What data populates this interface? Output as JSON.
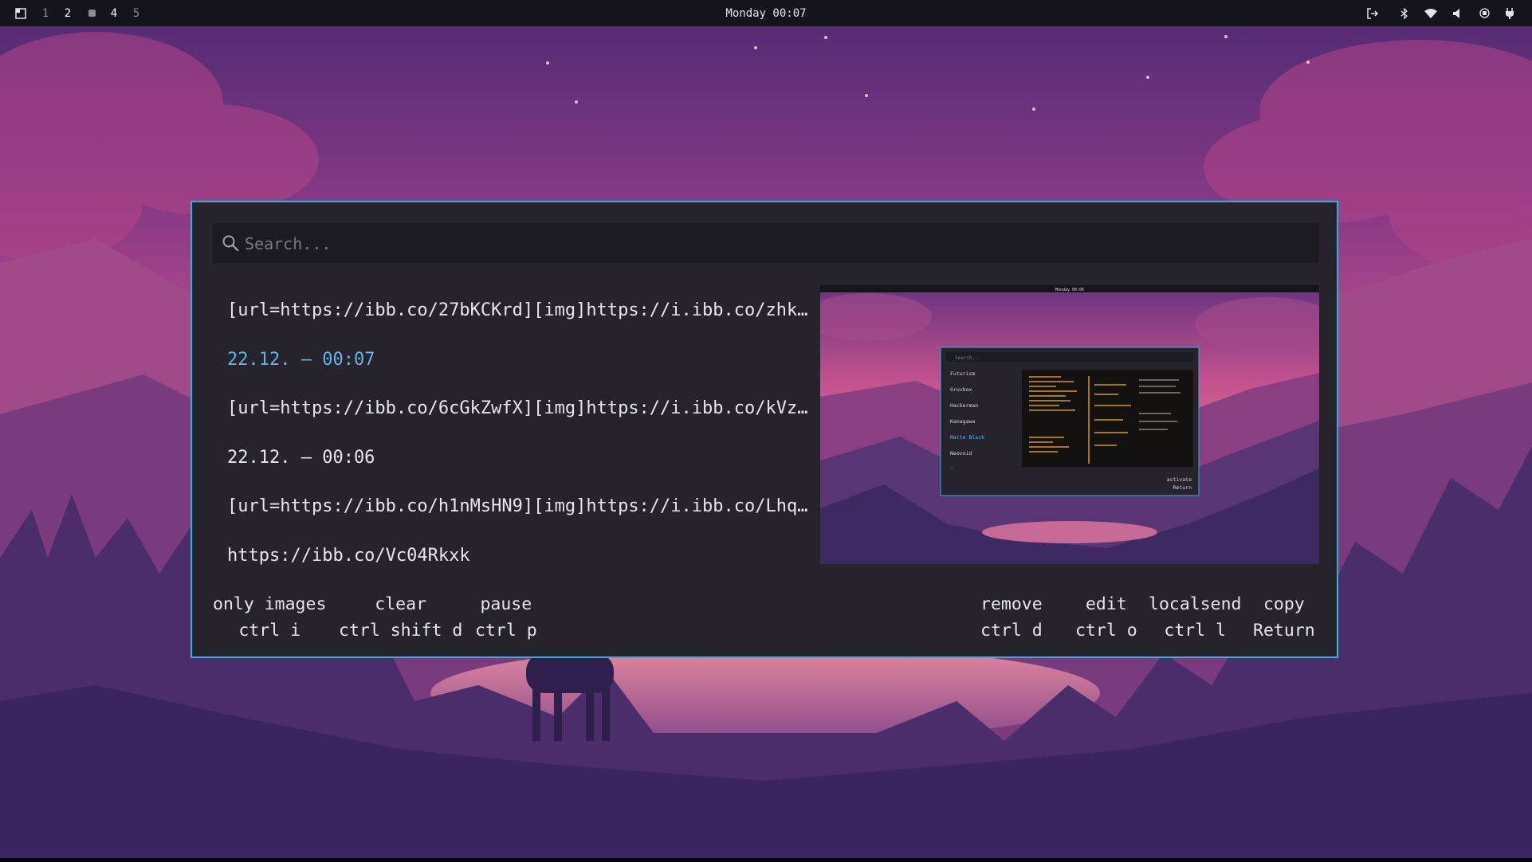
{
  "topbar": {
    "workspaces": [
      "1",
      "2",
      "",
      "4",
      "5"
    ],
    "active_workspace": "2",
    "clock": "Monday 00:07",
    "tray_icons": [
      "logout-icon",
      "bluetooth-icon",
      "wifi-icon",
      "volume-icon",
      "cpu-icon",
      "battery-icon"
    ]
  },
  "dialog": {
    "accent": "#2fb1de",
    "search": {
      "placeholder": "Search..."
    },
    "items": [
      "[url=https://ibb.co/27bKCKrd][img]https://i.ibb.co/zhk…",
      "22.12. – 00:07",
      "[url=https://ibb.co/6cGkZwfX][img]https://i.ibb.co/kVz…",
      "22.12. – 00:06",
      "[url=https://ibb.co/h1nMsHN9][img]https://i.ibb.co/Lhq…",
      "https://ibb.co/Vc04Rkxk"
    ],
    "selected_index": 1,
    "selected_color": "#5fb6e8",
    "preview": {
      "clock": "Monday 00:06",
      "search_placeholder": "Search...",
      "themes": [
        "Futurism",
        "Gruvbox",
        "Hackerman",
        "Kanagawa",
        "Matte Black",
        "Neovoid",
        "…"
      ],
      "selected_theme": "Matte Black",
      "hint_label": "activate",
      "hint_key": "Return"
    },
    "keybindings_left": [
      {
        "label": "only images",
        "key": "ctrl i"
      },
      {
        "label": "clear",
        "key": "ctrl shift d"
      },
      {
        "label": "pause",
        "key": "ctrl p"
      }
    ],
    "keybindings_right": [
      {
        "label": "remove",
        "key": "ctrl d"
      },
      {
        "label": "edit",
        "key": "ctrl o"
      },
      {
        "label": "localsend",
        "key": "ctrl l"
      },
      {
        "label": "copy",
        "key": "Return"
      }
    ]
  }
}
